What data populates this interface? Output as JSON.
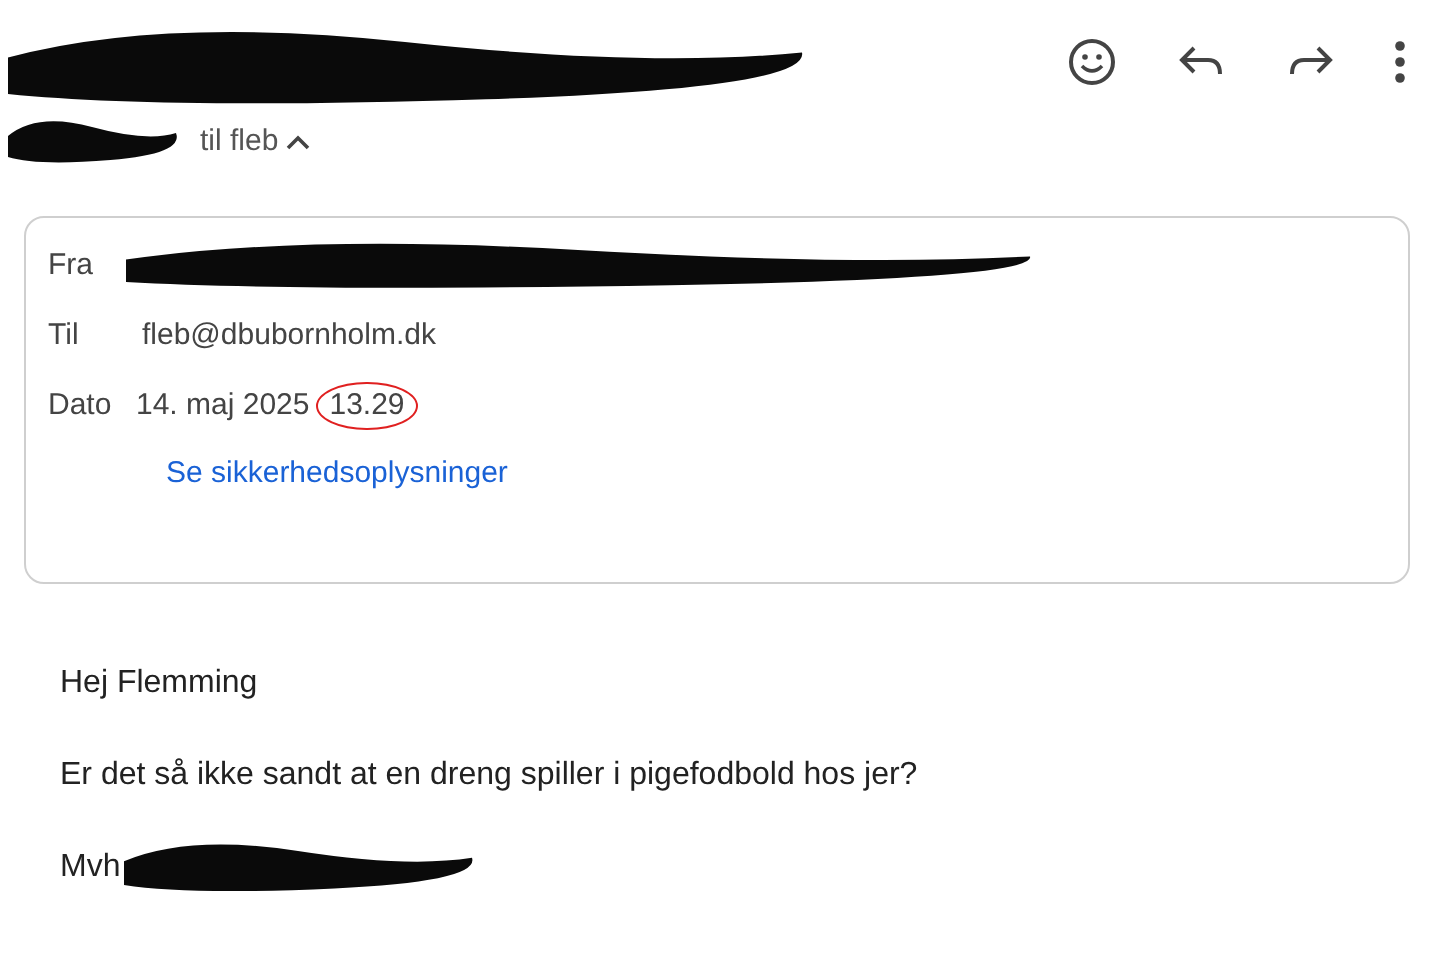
{
  "header": {
    "sender": {
      "kind": "redacted"
    },
    "recipient_line": "til fleb",
    "details_expanded": true
  },
  "details": [
    {
      "label": "Fra",
      "kind": "redacted"
    },
    {
      "label": "Til",
      "kind": "text",
      "value": "fleb@dbubornholm.dk"
    },
    {
      "label": "Dato",
      "kind": "date",
      "value": "14. maj 2025",
      "time": "13.29",
      "time_circled": true
    }
  ],
  "security_link": "Se sikkerhedsoplysninger",
  "body": [
    {
      "kind": "text",
      "text": "Hej Flemming"
    },
    {
      "kind": "text",
      "text": "Er det så ikke sandt at en dreng spiller i pigefodbold hos jer?"
    },
    {
      "kind": "signature",
      "text": "Mvh",
      "redacted": true
    }
  ]
}
